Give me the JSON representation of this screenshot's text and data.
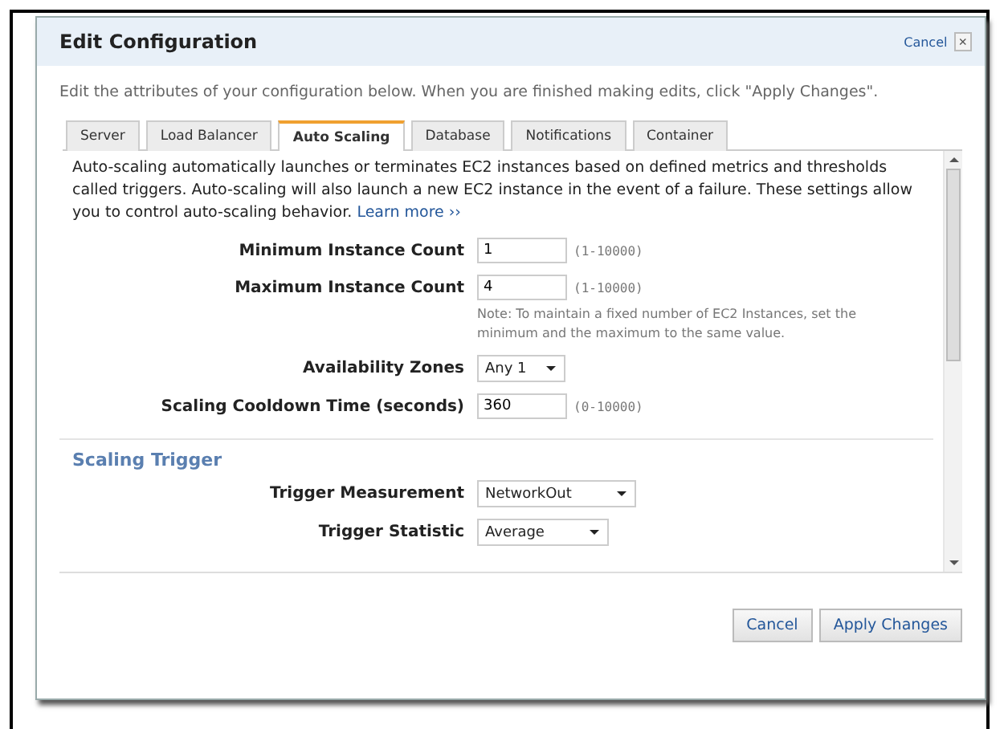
{
  "dialog": {
    "title": "Edit Configuration",
    "close_label": "Cancel",
    "close_glyph": "×"
  },
  "intro": "Edit the attributes of your configuration below. When you are finished making edits, click \"Apply Changes\".",
  "tabs": [
    {
      "label": "Server",
      "selected": false
    },
    {
      "label": "Load Balancer",
      "selected": false
    },
    {
      "label": "Auto Scaling",
      "selected": true
    },
    {
      "label": "Database",
      "selected": false
    },
    {
      "label": "Notifications",
      "selected": false
    },
    {
      "label": "Container",
      "selected": false
    }
  ],
  "description": {
    "text": "Auto-scaling automatically launches or terminates EC2 instances based on defined metrics and thresholds called triggers. Auto-scaling will also launch a new EC2 instance in the event of a failure. These settings allow you to control auto-scaling behavior.",
    "link": "Learn more ››"
  },
  "fields": [
    {
      "kind": "text",
      "label": "Minimum Instance Count",
      "value": "1",
      "hint": "(1-10000)"
    },
    {
      "kind": "text",
      "label": "Maximum Instance Count",
      "value": "4",
      "hint": "(1-10000)",
      "note": "Note: To maintain a fixed number of EC2 Instances, set the minimum and the maximum to the same value."
    },
    {
      "kind": "select",
      "label": "Availability Zones",
      "value": "Any 1"
    },
    {
      "kind": "text",
      "label": "Scaling Cooldown Time (seconds)",
      "value": "360",
      "hint": "(0-10000)"
    }
  ],
  "section": {
    "title": "Scaling Trigger",
    "fields": [
      {
        "kind": "select",
        "label": "Trigger Measurement",
        "value": "NetworkOut"
      },
      {
        "kind": "select",
        "label": "Trigger Statistic",
        "value": "Average"
      }
    ]
  },
  "buttons": [
    {
      "label": "Cancel"
    },
    {
      "label": "Apply Changes"
    }
  ]
}
